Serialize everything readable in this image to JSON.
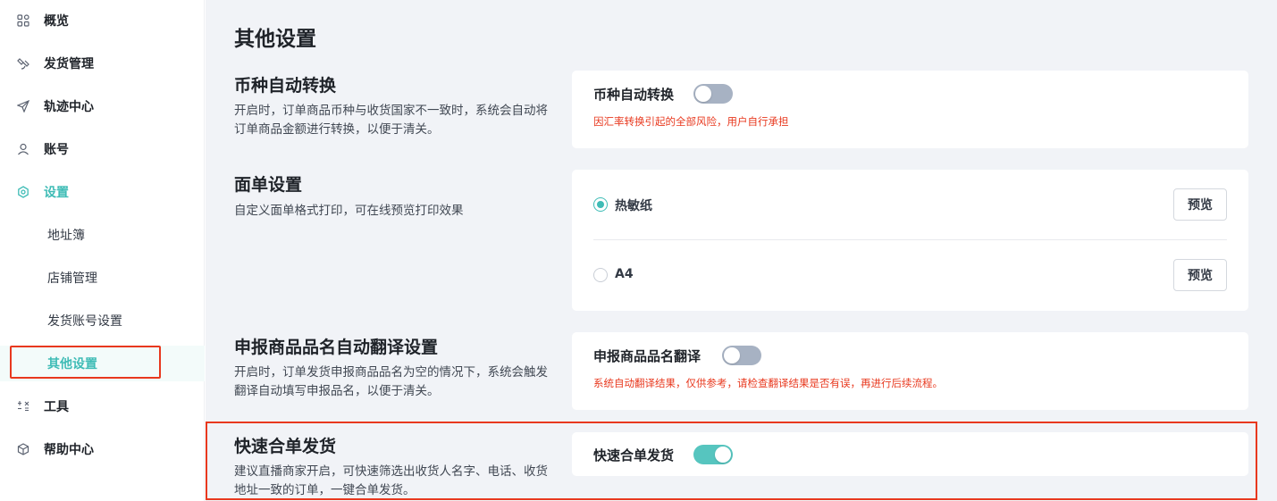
{
  "sidebar": {
    "items": [
      {
        "label": "概览",
        "icon": "grid-icon"
      },
      {
        "label": "发货管理",
        "icon": "satellite-icon"
      },
      {
        "label": "轨迹中心",
        "icon": "send-icon"
      },
      {
        "label": "账号",
        "icon": "user-icon"
      },
      {
        "label": "设置",
        "icon": "settings-icon"
      },
      {
        "label": "地址簿"
      },
      {
        "label": "店铺管理"
      },
      {
        "label": "发货账号设置"
      },
      {
        "label": "其他设置"
      },
      {
        "label": "工具",
        "icon": "tools-icon"
      },
      {
        "label": "帮助中心",
        "icon": "box-icon"
      }
    ]
  },
  "main": {
    "title": "其他设置",
    "currency": {
      "title": "币种自动转换",
      "desc": "开启时，订单商品币种与收货国家不一致时，系统会自动将订单商品金额进行转换，以便于清关。",
      "label": "币种自动转换",
      "enabled": false,
      "warning": "因汇率转换引起的全部风险，用户自行承担"
    },
    "label_settings": {
      "title": "面单设置",
      "desc": "自定义面单格式打印，可在线预览打印效果",
      "options": [
        {
          "label": "热敏纸",
          "selected": true,
          "button": "预览"
        },
        {
          "label": "A4",
          "selected": false,
          "button": "预览"
        }
      ]
    },
    "translate": {
      "title": "申报商品品名自动翻译设置",
      "desc": "开启时，订单发货申报商品品名为空的情况下，系统会触发翻译自动填写申报品名，以便于清关。",
      "label": "申报商品品名翻译",
      "enabled": false,
      "warning": "系统自动翻译结果，仅供参考，请检查翻译结果是否有误，再进行后续流程。"
    },
    "merge": {
      "title": "快速合单发货",
      "desc": "建议直播商家开启，可快速筛选出收货人名字、电话、收货地址一致的订单，一键合单发货。",
      "label": "快速合单发货",
      "enabled": true
    }
  },
  "colors": {
    "accent": "#3fbcb6",
    "warning": "#e8381e",
    "highlight_border": "#e8381e",
    "toggle_off": "#a7b2c3",
    "toggle_on": "#56c5bf"
  }
}
